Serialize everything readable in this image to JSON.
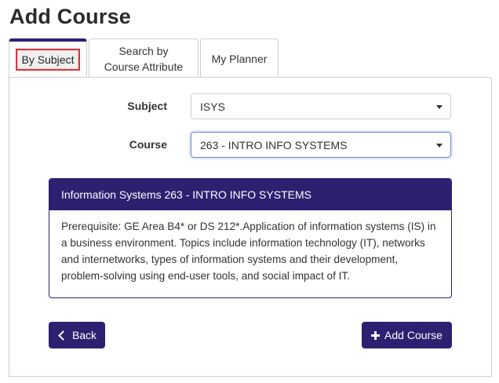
{
  "page": {
    "title": "Add Course"
  },
  "tabs": [
    {
      "label": "By Subject",
      "active": true
    },
    {
      "label": "Search by Course Attribute",
      "active": false
    },
    {
      "label": "My Planner",
      "active": false
    }
  ],
  "form": {
    "subject_label": "Subject",
    "subject_value": "ISYS",
    "course_label": "Course",
    "course_value": "263 - INTRO INFO SYSTEMS"
  },
  "course_card": {
    "title": "Information Systems 263 - INTRO INFO SYSTEMS",
    "description": "Prerequisite: GE Area B4* or DS 212*.Application of information systems (IS) in a business environment. Topics include information technology (IT), networks and internetworks, types of information systems and their development, problem-solving using end-user tools, and social impact of IT."
  },
  "buttons": {
    "back_label": "Back",
    "add_label": "Add Course"
  },
  "icons": {
    "back": "chevron-left-icon",
    "add": "plus-icon",
    "dropdown": "caret-down-icon"
  },
  "colors": {
    "primary": "#2c2170",
    "highlight": "#d9343c",
    "focus": "#6d8fc9"
  }
}
